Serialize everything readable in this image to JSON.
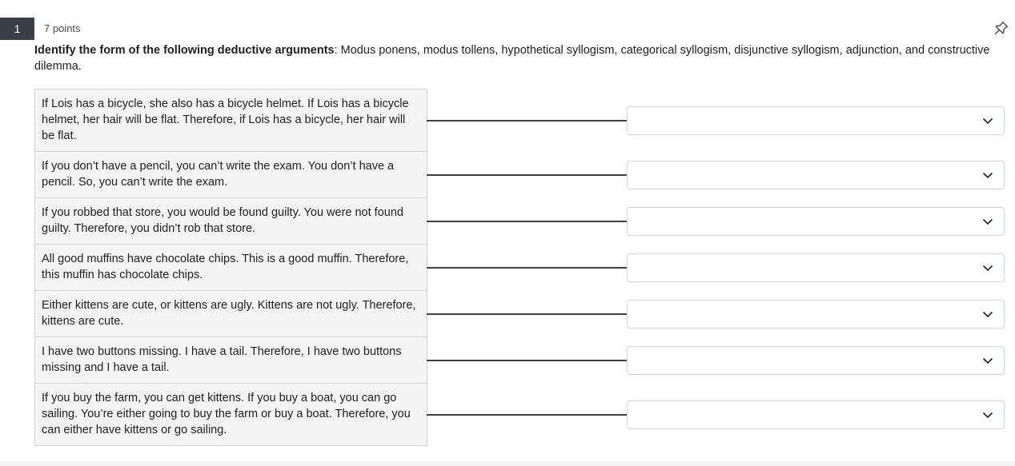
{
  "question": {
    "number": "1",
    "points": "7 points",
    "prompt_bold": "Identify the form of the following deductive arguments",
    "prompt_rest": ": Modus ponens, modus tollens, hypothetical syllogism, categorical syllogism, disjunctive syllogism, adjunction, and constructive dilemma."
  },
  "items": [
    {
      "text": "If Lois has a bicycle, she also has a bicycle helmet. If Lois has a bicycle helmet, her hair will be flat. Therefore, if Lois has a bicycle, her hair will be flat.",
      "selected": ""
    },
    {
      "text": "If you don’t have a pencil, you can’t write the exam. You don’t have a pencil. So, you can’t write the exam.",
      "selected": ""
    },
    {
      "text": "If you robbed that store, you would be found guilty. You were not found guilty. Therefore, you didn’t rob that store.",
      "selected": ""
    },
    {
      "text": "All good muffins have chocolate chips. This is a good muffin. Therefore, this muffin has chocolate chips.",
      "selected": ""
    },
    {
      "text": "Either kittens are cute, or kittens are ugly. Kittens are not ugly. Therefore, kittens are cute.",
      "selected": ""
    },
    {
      "text": "I have two buttons missing. I have a tail. Therefore, I have two buttons missing and I have a tail.",
      "selected": ""
    },
    {
      "text": "If you buy the farm, you can get kittens. If you buy a boat, you can go sailing. You’re either going to buy the farm or buy a boat. Therefore, you can either have kittens or go sailing.",
      "selected": ""
    }
  ],
  "icons": {
    "pin": "pin-icon",
    "dropdown": "chevron-down-icon"
  },
  "colors": {
    "badge": "#3b4046",
    "card_bg": "#f4f4f4",
    "connector": "#3b4046",
    "select_border": "#cdd5dc"
  }
}
